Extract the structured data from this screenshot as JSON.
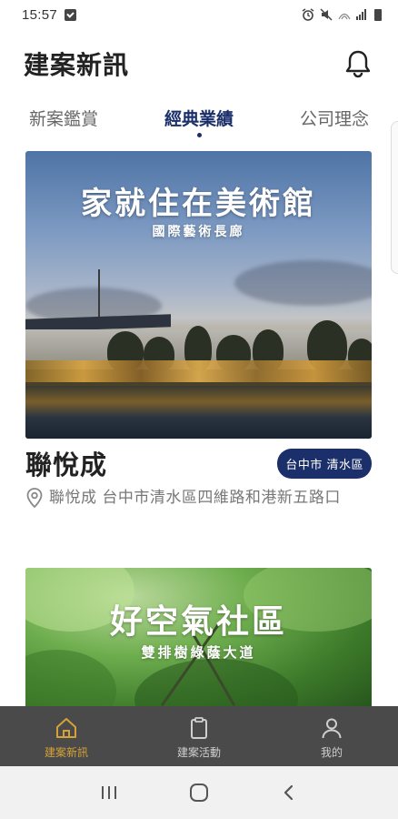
{
  "status": {
    "time": "15:57"
  },
  "header": {
    "title": "建案新訊"
  },
  "tabs": [
    {
      "label": "新案鑑賞"
    },
    {
      "label": "經典業績"
    },
    {
      "label": "公司理念"
    }
  ],
  "cards": [
    {
      "headline": "家就住在美術館",
      "subheadline": "國際藝術長廊",
      "name": "聯悅成",
      "district": "台中市 清水區",
      "address": "聯悅成 台中市清水區四維路和港新五路口"
    },
    {
      "headline": "好空氣社區",
      "subheadline": "雙排樹綠蔭大道"
    }
  ],
  "bottom_nav": [
    {
      "label": "建案新訊",
      "icon": "home-icon",
      "active": true
    },
    {
      "label": "建案活動",
      "icon": "clipboard-icon",
      "active": false
    },
    {
      "label": "我的",
      "icon": "person-icon",
      "active": false
    }
  ],
  "colors": {
    "accent": "#1b2f6a",
    "nav_active": "#d6a238",
    "nav_bg": "#4a4a4a"
  }
}
